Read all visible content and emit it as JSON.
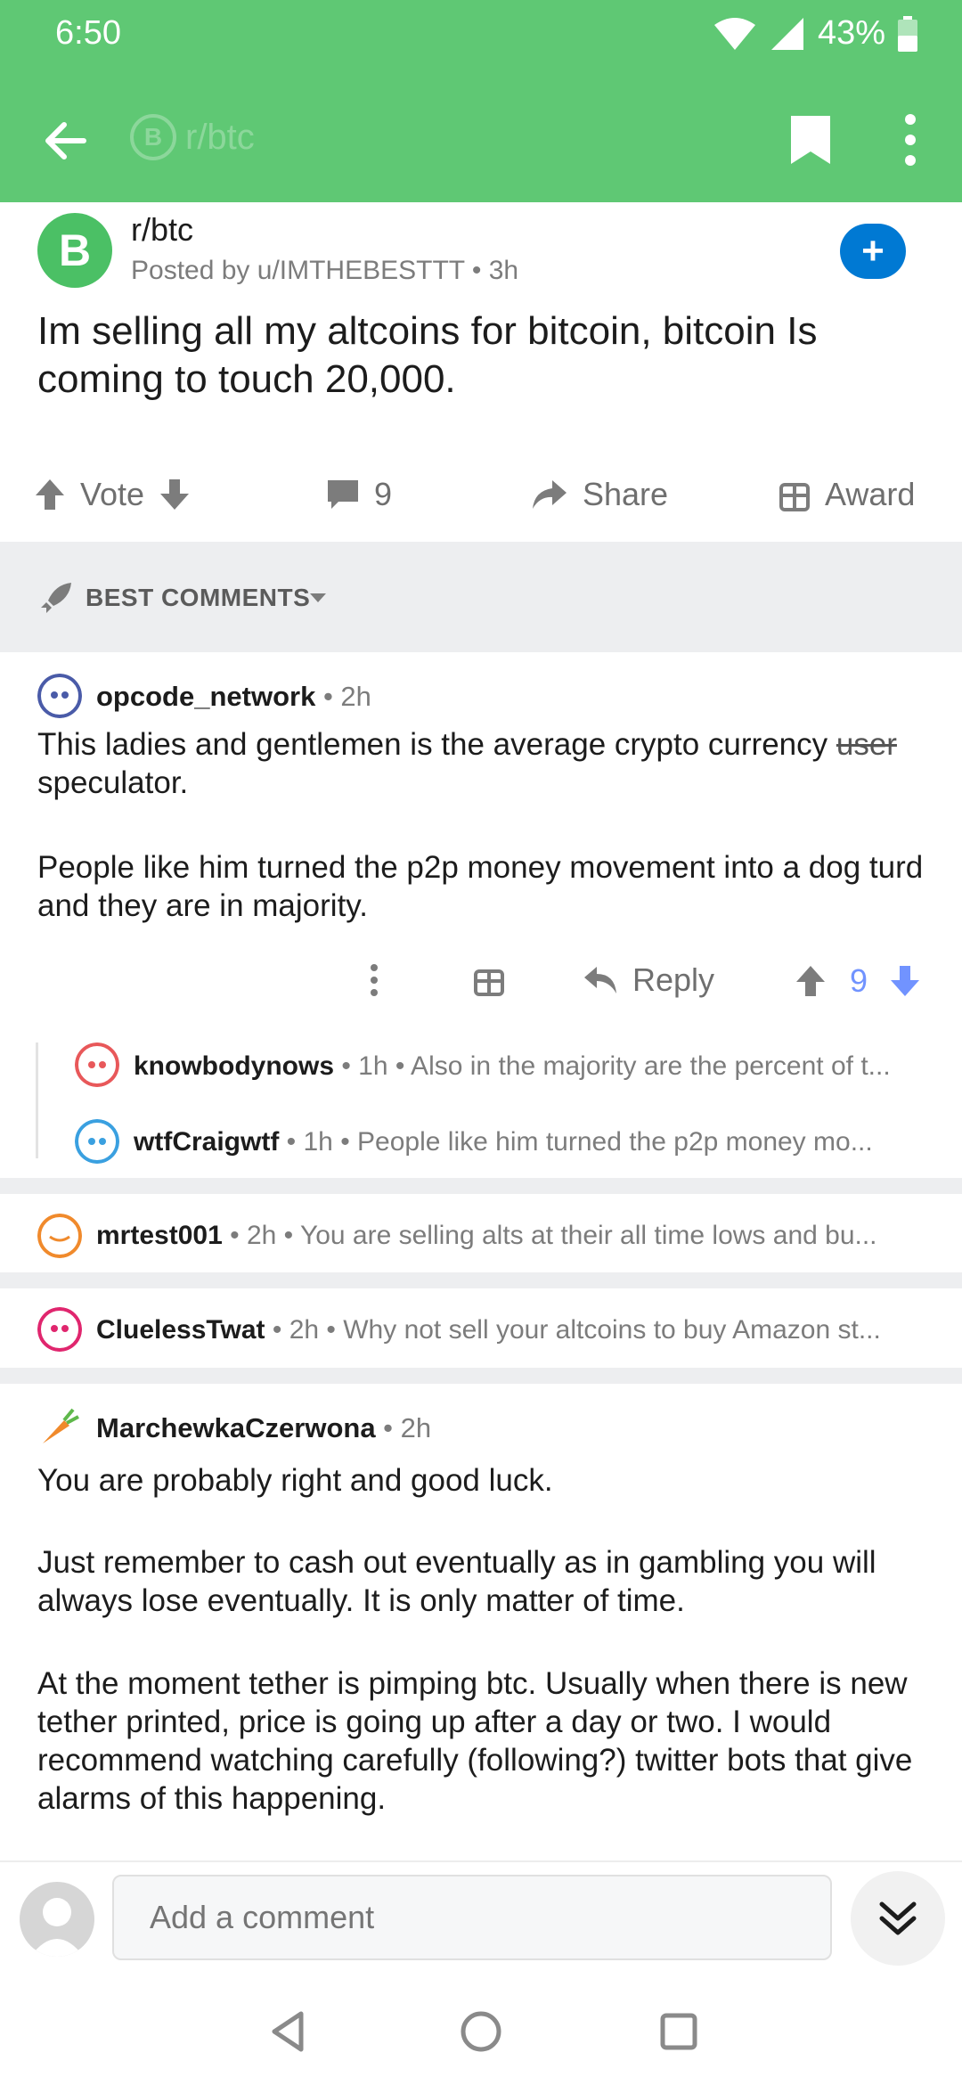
{
  "status": {
    "time": "6:50",
    "battery": "43%"
  },
  "appbar": {
    "subreddit_faded": "r/btc",
    "coin_symbol": "B"
  },
  "post": {
    "subreddit": "r/btc",
    "posted_by": "Posted by u/IMTHEBESTTT • 3h",
    "title": "Im selling all my altcoins for bitcoin, bitcoin Is coming to touch 20,000.",
    "vote_label": "Vote",
    "comment_count": "9",
    "share_label": "Share",
    "award_label": "Award",
    "join_symbol": "+"
  },
  "sort": {
    "label": "BEST COMMENTS"
  },
  "comments": {
    "c1": {
      "user": "opcode_network",
      "meta": " • 2h",
      "body_a": "This ladies and gentlemen is the average crypto currency ",
      "body_strike": "user",
      "body_b": " speculator.",
      "body_p2": "People like him turned the p2p money movement into a dog turd and they are in majority.",
      "reply_label": "Reply",
      "score": "9"
    },
    "r1": {
      "user": "knowbodynows",
      "meta": " • 1h • Also in the majority are the percent of t..."
    },
    "r2": {
      "user": "wtfCraigwtf",
      "meta": " • 1h •  People like him turned the p2p money mo..."
    },
    "c2": {
      "user": "mrtest001",
      "meta": " • 2h • You are selling alts at their all time lows and bu..."
    },
    "c3": {
      "user": "CluelessTwat",
      "meta": " • 2h • Why not sell your altcoins to buy Amazon st..."
    },
    "c4": {
      "user": "MarchewkaCzerwona",
      "meta": " • 2h",
      "p1": "You are probably right and good luck.",
      "p2": "Just remember to cash out eventually as in gambling you will always lose eventually. It is only matter of time.",
      "p3": "At the moment tether is pimping btc. Usually when there is new tether printed, price is going up after a day or two. I would recommend watching carefully (following?) twitter bots that give alarms of this happening."
    }
  },
  "composer": {
    "placeholder": "Add a comment"
  },
  "colors": {
    "bar": "#5fc874",
    "accent": "#0079d3",
    "vote": "#7193ff"
  }
}
